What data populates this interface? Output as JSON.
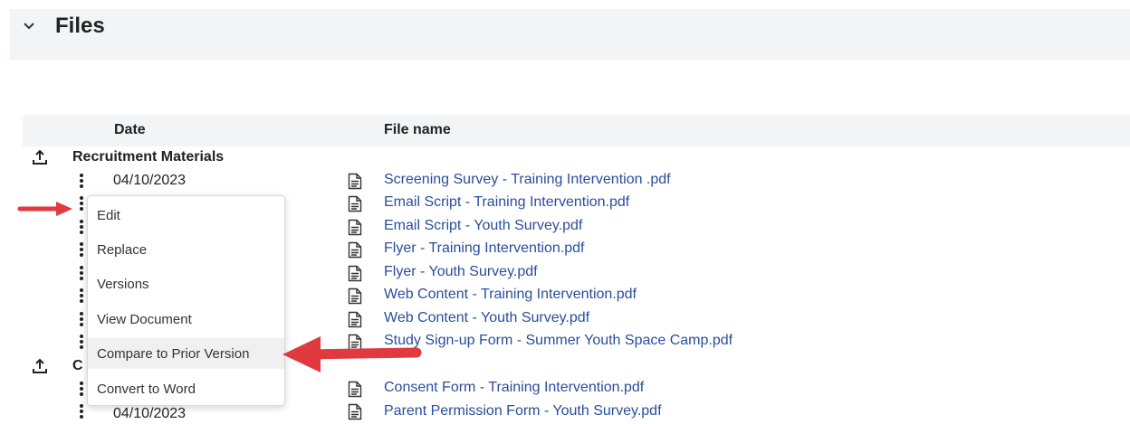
{
  "section": {
    "title": "Files"
  },
  "table": {
    "headers": {
      "date": "Date",
      "file_name": "File name"
    },
    "groups": [
      {
        "label": "Recruitment Materials"
      },
      {
        "label": "C"
      }
    ]
  },
  "rows": {
    "r0": {
      "date": "04/10/2023",
      "file": "Screening Survey - Training Intervention .pdf"
    },
    "r1": {
      "file": "Email Script - Training Intervention.pdf"
    },
    "r2": {
      "file": "Email Script - Youth Survey.pdf"
    },
    "r3": {
      "file": "Flyer - Training Intervention.pdf"
    },
    "r4": {
      "file": "Flyer - Youth Survey.pdf"
    },
    "r5": {
      "file": "Web Content - Training Intervention.pdf"
    },
    "r6": {
      "file": "Web Content - Youth Survey.pdf"
    },
    "r7": {
      "file": "Study Sign-up Form - Summer Youth Space Camp.pdf"
    },
    "r8": {
      "file": "Consent Form - Training Intervention.pdf"
    },
    "r9": {
      "date": "04/10/2023",
      "file": "Parent Permission Form - Youth Survey.pdf"
    }
  },
  "menu": {
    "items": [
      "Edit",
      "Replace",
      "Versions",
      "View Document",
      "Compare to Prior Version",
      "Convert to Word"
    ]
  },
  "colors": {
    "link": "#2a4e9b",
    "arrow": "#e0393e",
    "header_bg": "#f3f4f6"
  },
  "icons": [
    "chevron-down-icon",
    "upload-icon",
    "kebab-icon",
    "document-icon"
  ]
}
